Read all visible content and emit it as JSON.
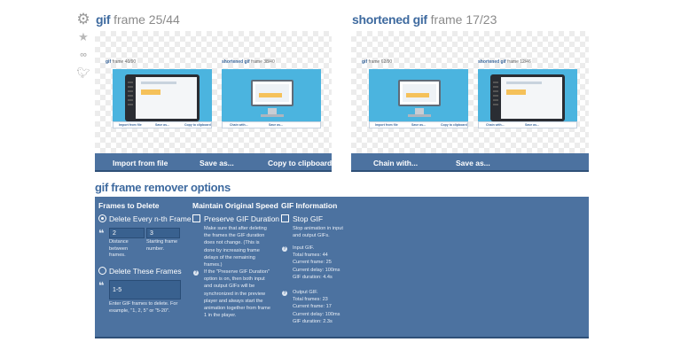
{
  "left_player": {
    "name": "gif",
    "frame_text": "frame 25/44",
    "toolbar": {
      "import_label": "Import from file",
      "save_label": "Save as...",
      "copy_label": "Copy to clipboard"
    },
    "mini_left": {
      "name": "gif",
      "frame_text": "frame 40/90",
      "bar": [
        "Import from file",
        "Save as...",
        "Copy to clipboard"
      ]
    },
    "mini_right": {
      "name": "shortened gif",
      "frame_text": "frame 38/40",
      "bar": [
        "Chain with...",
        "Save as..."
      ]
    }
  },
  "right_player": {
    "name": "shortened gif",
    "frame_text": "frame 17/23",
    "toolbar": {
      "chain_label": "Chain with...",
      "save_label": "Save as..."
    },
    "mini_left": {
      "name": "gif",
      "frame_text": "frame 62/90",
      "bar": [
        "Import from file",
        "Save as...",
        "Copy to clipboard"
      ]
    },
    "mini_right": {
      "name": "shortened gif",
      "frame_text": "frame 12/46",
      "bar": [
        "Chain with...",
        "Save as..."
      ]
    }
  },
  "side_icons": [
    "gear-icon",
    "star-icon",
    "link-icon",
    "twitter-icon"
  ],
  "options": {
    "title": "gif frame remover options",
    "frames_to_delete": {
      "heading": "Frames to Delete",
      "every_nth_label": "Delete Every n-th Frame",
      "distance_value": "2",
      "distance_label": "Distance between frames.",
      "start_value": "3",
      "start_label": "Starting frame number.",
      "these_frames_label": "Delete These Frames",
      "these_frames_value": "1-5",
      "these_frames_help": "Enter GIF frames to delete. For example, \"1, 2, 5\" or \"5-20\"."
    },
    "maintain_speed": {
      "heading": "Maintain Original Speed",
      "checkbox_label": "Preserve GIF Duration",
      "help": "Make sure that after deleting the frames the GIF duration does not change. (This is done by increasing frame delays of the remaining frames.)",
      "note": "If the \"Preserve GIF Duration\" option is on, then both input and output GIFs will be synchronized in the preview player and always start the animation together from frame 1 in the player."
    },
    "gif_information": {
      "heading": "GIF Information",
      "stop_label": "Stop GIF",
      "stop_help": "Stop animation in input and output GIFs.",
      "input": {
        "title": "Input GIF.",
        "total_frames": "Total frames: 44",
        "current_frame": "Current frame: 25",
        "current_delay": "Current delay: 100ms",
        "duration": "GIF duration: 4.4s"
      },
      "output": {
        "title": "Output GIF.",
        "total_frames": "Total frames: 23",
        "current_frame": "Current frame: 17",
        "current_delay": "Current delay: 100ms",
        "duration": "GIF duration: 2.3s"
      }
    }
  }
}
